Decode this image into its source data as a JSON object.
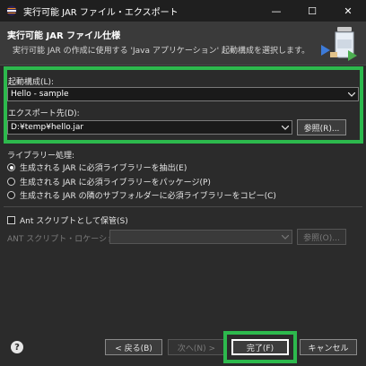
{
  "window": {
    "title": "実行可能 JAR ファイル・エクスポート",
    "minimize": "—",
    "maximize": "☐",
    "close": "✕"
  },
  "header": {
    "title": "実行可能 JAR ファイル仕様",
    "description": "実行可能 JAR の作成に使用する 'Java アプリケーション' 起動構成を選択します。"
  },
  "launch_config": {
    "label": "起動構成(L):",
    "value": "Hello - sample"
  },
  "export_dest": {
    "label": "エクスポート先(D):",
    "value": "D:¥temp¥hello.jar",
    "browse_label": "参照(R)..."
  },
  "library": {
    "label": "ライブラリー処理:",
    "options": [
      {
        "label": "生成される JAR に必須ライブラリーを抽出(E)",
        "selected": true
      },
      {
        "label": "生成される JAR に必須ライブラリーをパッケージ(P)",
        "selected": false
      },
      {
        "label": "生成される JAR の隣のサブフォルダーに必須ライブラリーをコピー(C)",
        "selected": false
      }
    ]
  },
  "ant": {
    "checkbox_label": "Ant スクリプトとして保管(S)",
    "checked": false,
    "location_label": "ANT スクリプト・ロケーション(A):",
    "location_value": "",
    "browse_label": "参照(O)..."
  },
  "footer": {
    "help": "?",
    "back_label": "< 戻る(B)",
    "next_label": "次へ(N) >",
    "finish_label": "完了(F)",
    "cancel_label": "キャンセル"
  },
  "colors": {
    "highlight": "#2db94d",
    "background": "#2b2b2b",
    "header_bg": "#3a3a3a"
  }
}
